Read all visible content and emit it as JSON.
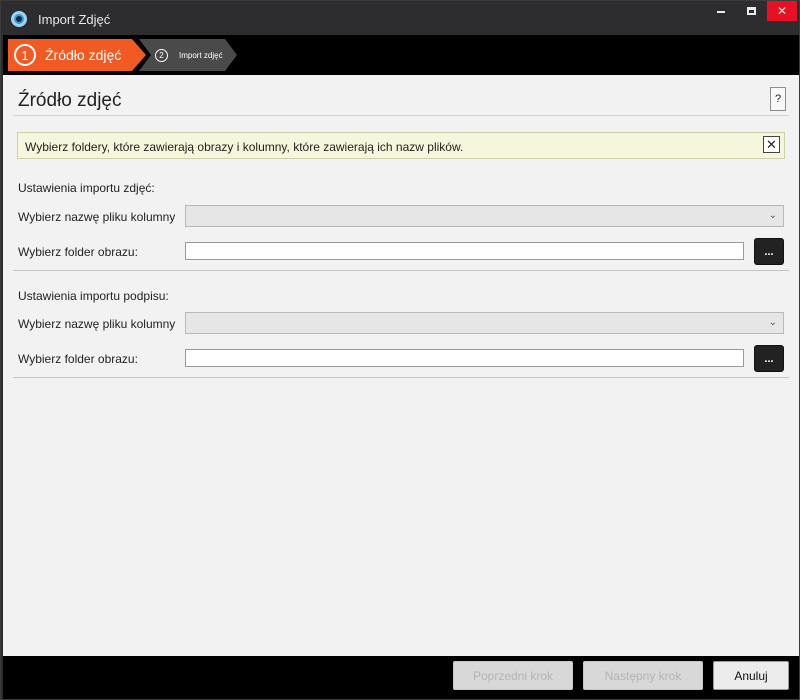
{
  "window": {
    "title": "Import Zdjęć"
  },
  "steps": [
    {
      "number": "1",
      "label": "Źródło zdjęć",
      "active": true
    },
    {
      "number": "2",
      "label": "Import zdjęć",
      "active": false
    }
  ],
  "page": {
    "title": "Źródło zdjęć",
    "help_label": "?"
  },
  "info_banner": {
    "text": "Wybierz foldery, które zawierają obrazy i kolumny, które zawierają ich nazw plików.",
    "close_label": "✕"
  },
  "photo_section": {
    "title": "Ustawienia importu zdjęć:",
    "column_label": "Wybierz nazwę pliku kolumny",
    "column_value": "",
    "folder_label": "Wybierz folder obrazu:",
    "folder_value": "",
    "browse_label": "..."
  },
  "signature_section": {
    "title": "Ustawienia importu podpisu:",
    "column_label": "Wybierz nazwę pliku kolumny",
    "column_value": "",
    "folder_label": "Wybierz folder obrazu:",
    "folder_value": "",
    "browse_label": "..."
  },
  "footer": {
    "prev_label": "Poprzedni krok",
    "next_label": "Następny krok",
    "cancel_label": "Anuluj"
  },
  "colors": {
    "accent": "#f15a22",
    "close_button": "#e81123"
  },
  "icons": {
    "app": "app-logo-icon",
    "dropdown": "chevron-down-icon"
  }
}
